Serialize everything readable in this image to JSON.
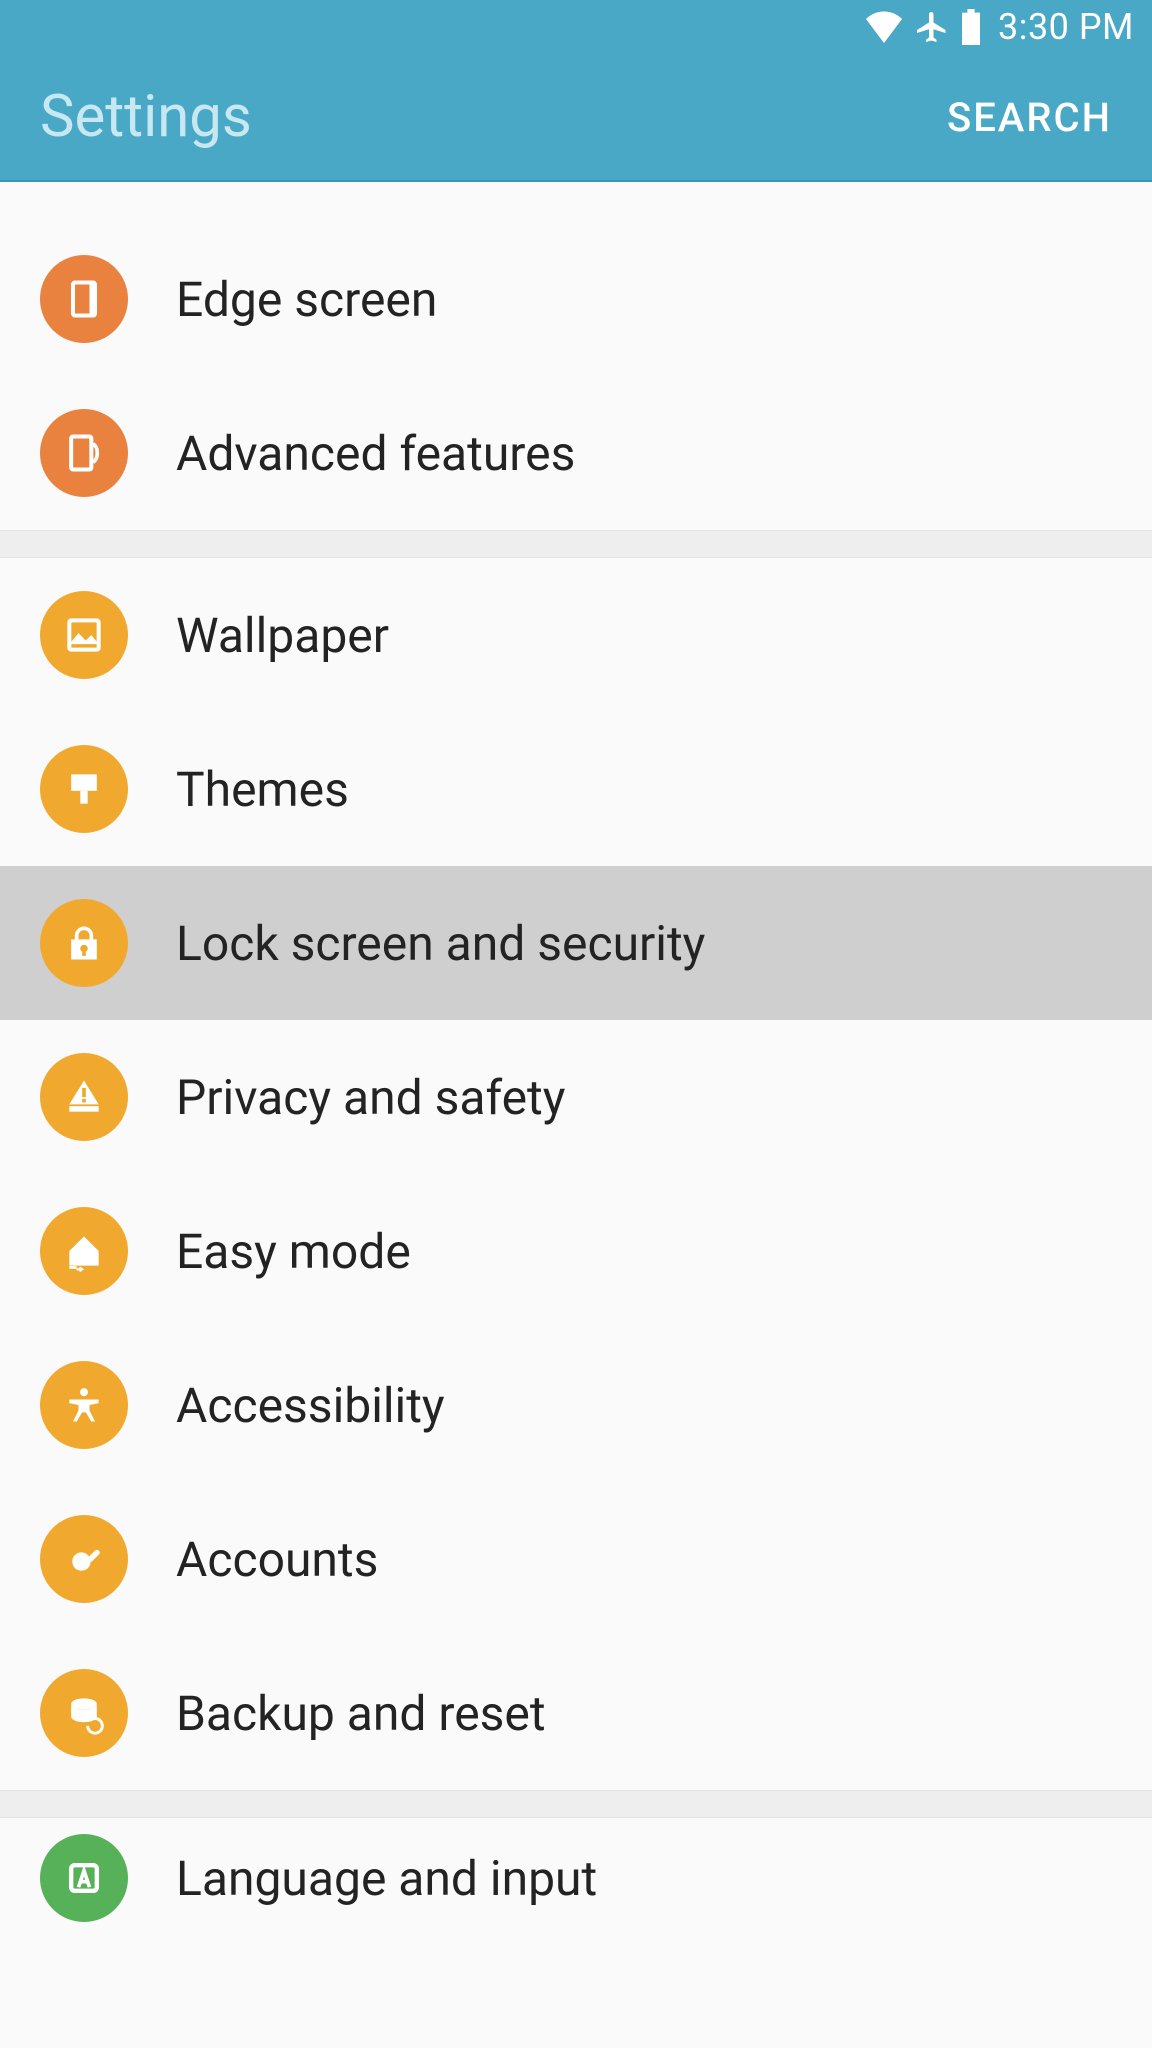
{
  "status": {
    "time": "3:30 PM"
  },
  "header": {
    "title": "Settings",
    "search": "SEARCH"
  },
  "rows": {
    "edge_screen": "Edge screen",
    "advanced_features": "Advanced features",
    "wallpaper": "Wallpaper",
    "themes": "Themes",
    "lock_screen_security": "Lock screen and security",
    "privacy_safety": "Privacy and safety",
    "easy_mode": "Easy mode",
    "accessibility": "Accessibility",
    "accounts": "Accounts",
    "backup_reset": "Backup and reset",
    "language_input": "Language and input"
  }
}
